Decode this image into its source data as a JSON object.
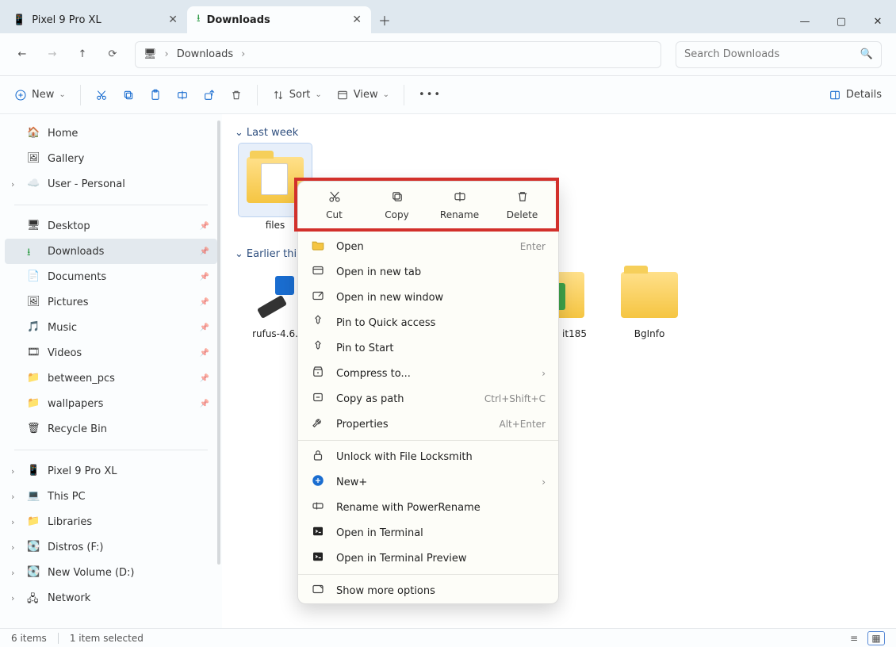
{
  "tabs": [
    {
      "label": "Pixel 9 Pro XL",
      "icon": "phone"
    },
    {
      "label": "Downloads",
      "icon": "download"
    }
  ],
  "wincontrols": {
    "min": "—",
    "max": "▢",
    "close": "✕"
  },
  "address": {
    "location": "Downloads"
  },
  "search": {
    "placeholder": "Search Downloads"
  },
  "cmdbar": {
    "new": "New",
    "sort": "Sort",
    "view": "View",
    "details": "Details"
  },
  "nav": {
    "top": [
      {
        "label": "Home",
        "icon": "home",
        "chev": false
      },
      {
        "label": "Gallery",
        "icon": "gallery",
        "chev": false
      },
      {
        "label": "User - Personal",
        "icon": "cloud",
        "chev": true
      }
    ],
    "quick": [
      {
        "label": "Desktop",
        "icon": "desktop",
        "pin": true
      },
      {
        "label": "Downloads",
        "icon": "download",
        "pin": true,
        "active": true
      },
      {
        "label": "Documents",
        "icon": "document",
        "pin": true
      },
      {
        "label": "Pictures",
        "icon": "pictures",
        "pin": true
      },
      {
        "label": "Music",
        "icon": "music",
        "pin": true
      },
      {
        "label": "Videos",
        "icon": "videos",
        "pin": true
      },
      {
        "label": "between_pcs",
        "icon": "folder",
        "pin": true
      },
      {
        "label": "wallpapers",
        "icon": "folder",
        "pin": true
      },
      {
        "label": "Recycle Bin",
        "icon": "recycle",
        "pin": false
      }
    ],
    "bottom": [
      {
        "label": "Pixel 9 Pro XL",
        "icon": "phone",
        "chev": true
      },
      {
        "label": "This PC",
        "icon": "pc",
        "chev": true
      },
      {
        "label": "Libraries",
        "icon": "folder",
        "chev": true
      },
      {
        "label": "Distros (F:)",
        "icon": "drive",
        "chev": true
      },
      {
        "label": "New Volume (D:)",
        "icon": "drive",
        "chev": true
      },
      {
        "label": "Network",
        "icon": "network",
        "chev": true
      }
    ]
  },
  "groups": [
    {
      "label": "Last week",
      "items": [
        {
          "name": "files",
          "type": "folder-docs",
          "selected": true
        }
      ]
    },
    {
      "label": "Earlier thi",
      "items": [
        {
          "name": "rufus-4.6.",
          "type": "usb-app"
        },
        {
          "name": "",
          "type": "hidden"
        },
        {
          "name": "",
          "type": "hidden"
        },
        {
          "name": "it185",
          "type": "folder-app2",
          "clip": true
        },
        {
          "name": "BgInfo",
          "type": "folder-zip"
        }
      ]
    }
  ],
  "ctx": {
    "top": [
      {
        "label": "Cut",
        "icon": "cut"
      },
      {
        "label": "Copy",
        "icon": "copy"
      },
      {
        "label": "Rename",
        "icon": "rename"
      },
      {
        "label": "Delete",
        "icon": "delete"
      }
    ],
    "rows": [
      {
        "label": "Open",
        "icon": "folder-open",
        "short": "Enter"
      },
      {
        "label": "Open in new tab",
        "icon": "tab"
      },
      {
        "label": "Open in new window",
        "icon": "window"
      },
      {
        "label": "Pin to Quick access",
        "icon": "pin"
      },
      {
        "label": "Pin to Start",
        "icon": "pin"
      },
      {
        "label": "Compress to...",
        "icon": "archive",
        "chev": true
      },
      {
        "label": "Copy as path",
        "icon": "path",
        "short": "Ctrl+Shift+C"
      },
      {
        "label": "Properties",
        "icon": "wrench",
        "short": "Alt+Enter"
      },
      {
        "sep": true
      },
      {
        "label": "Unlock with File Locksmith",
        "icon": "lock"
      },
      {
        "label": "New+",
        "icon": "plus",
        "chev": true
      },
      {
        "label": "Rename with PowerRename",
        "icon": "rename2"
      },
      {
        "label": "Open in Terminal",
        "icon": "terminal"
      },
      {
        "label": "Open in Terminal Preview",
        "icon": "terminal"
      },
      {
        "sep": true
      },
      {
        "label": "Show more options",
        "icon": "more"
      }
    ]
  },
  "status": {
    "count": "6 items",
    "selected": "1 item selected"
  }
}
